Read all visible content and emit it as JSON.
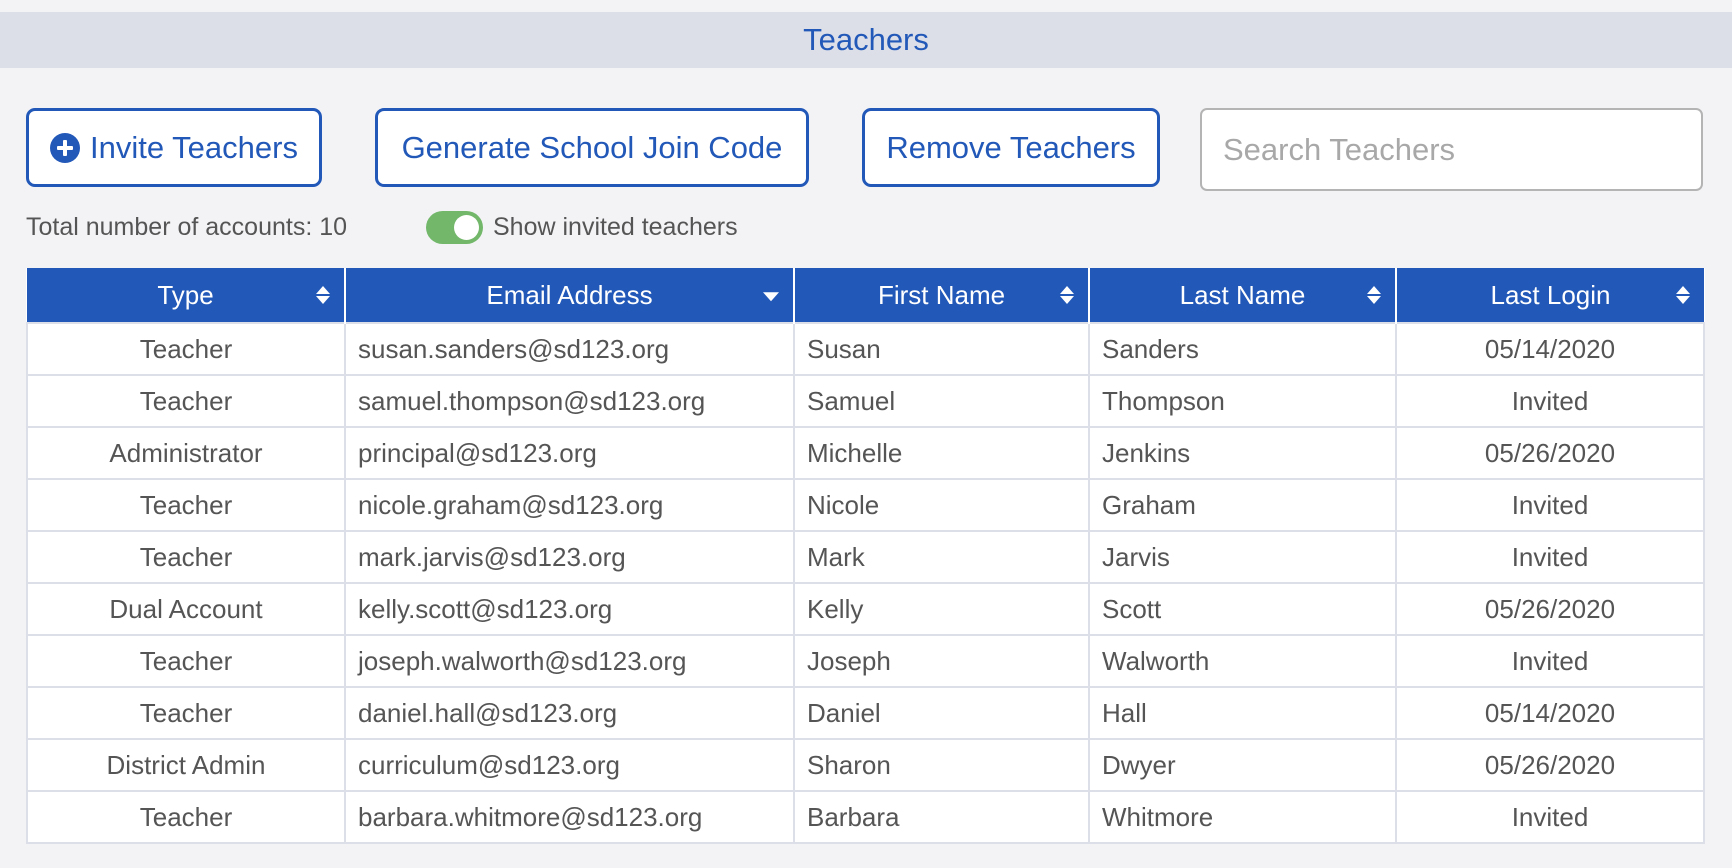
{
  "header": {
    "title": "Teachers"
  },
  "toolbar": {
    "invite_label": "Invite Teachers",
    "invite_icon": "plus-circle-icon",
    "generate_label": "Generate School Join Code",
    "remove_label": "Remove Teachers",
    "search_placeholder": "Search Teachers",
    "search_value": ""
  },
  "summary": {
    "total_label": "Total number of accounts: 10",
    "total_count": 10,
    "toggle_label": "Show invited teachers",
    "toggle_on": true,
    "toggle_color": "#72b76a"
  },
  "colors": {
    "accent": "#2258b8",
    "title_bar": "#dcdfe8",
    "background": "#f3f3f6"
  },
  "table": {
    "columns": [
      {
        "label": "Type",
        "sort": "none"
      },
      {
        "label": "Email Address",
        "sort": "descending"
      },
      {
        "label": "First Name",
        "sort": "none"
      },
      {
        "label": "Last Name",
        "sort": "none"
      },
      {
        "label": "Last Login",
        "sort": "none"
      }
    ],
    "rows": [
      {
        "type": "Teacher",
        "email": "susan.sanders@sd123.org",
        "first": "Susan",
        "last": "Sanders",
        "login": "05/14/2020"
      },
      {
        "type": "Teacher",
        "email": "samuel.thompson@sd123.org",
        "first": "Samuel",
        "last": "Thompson",
        "login": "Invited"
      },
      {
        "type": "Administrator",
        "email": "principal@sd123.org",
        "first": "Michelle",
        "last": "Jenkins",
        "login": "05/26/2020"
      },
      {
        "type": "Teacher",
        "email": "nicole.graham@sd123.org",
        "first": "Nicole",
        "last": "Graham",
        "login": "Invited"
      },
      {
        "type": "Teacher",
        "email": "mark.jarvis@sd123.org",
        "first": "Mark",
        "last": "Jarvis",
        "login": "Invited"
      },
      {
        "type": "Dual Account",
        "email": "kelly.scott@sd123.org",
        "first": "Kelly",
        "last": "Scott",
        "login": "05/26/2020"
      },
      {
        "type": "Teacher",
        "email": "joseph.walworth@sd123.org",
        "first": "Joseph",
        "last": "Walworth",
        "login": "Invited"
      },
      {
        "type": "Teacher",
        "email": "daniel.hall@sd123.org",
        "first": "Daniel",
        "last": "Hall",
        "login": "05/14/2020"
      },
      {
        "type": "District Admin",
        "email": "curriculum@sd123.org",
        "first": "Sharon",
        "last": "Dwyer",
        "login": "05/26/2020"
      },
      {
        "type": "Teacher",
        "email": "barbara.whitmore@sd123.org",
        "first": "Barbara",
        "last": "Whitmore",
        "login": "Invited"
      }
    ]
  }
}
